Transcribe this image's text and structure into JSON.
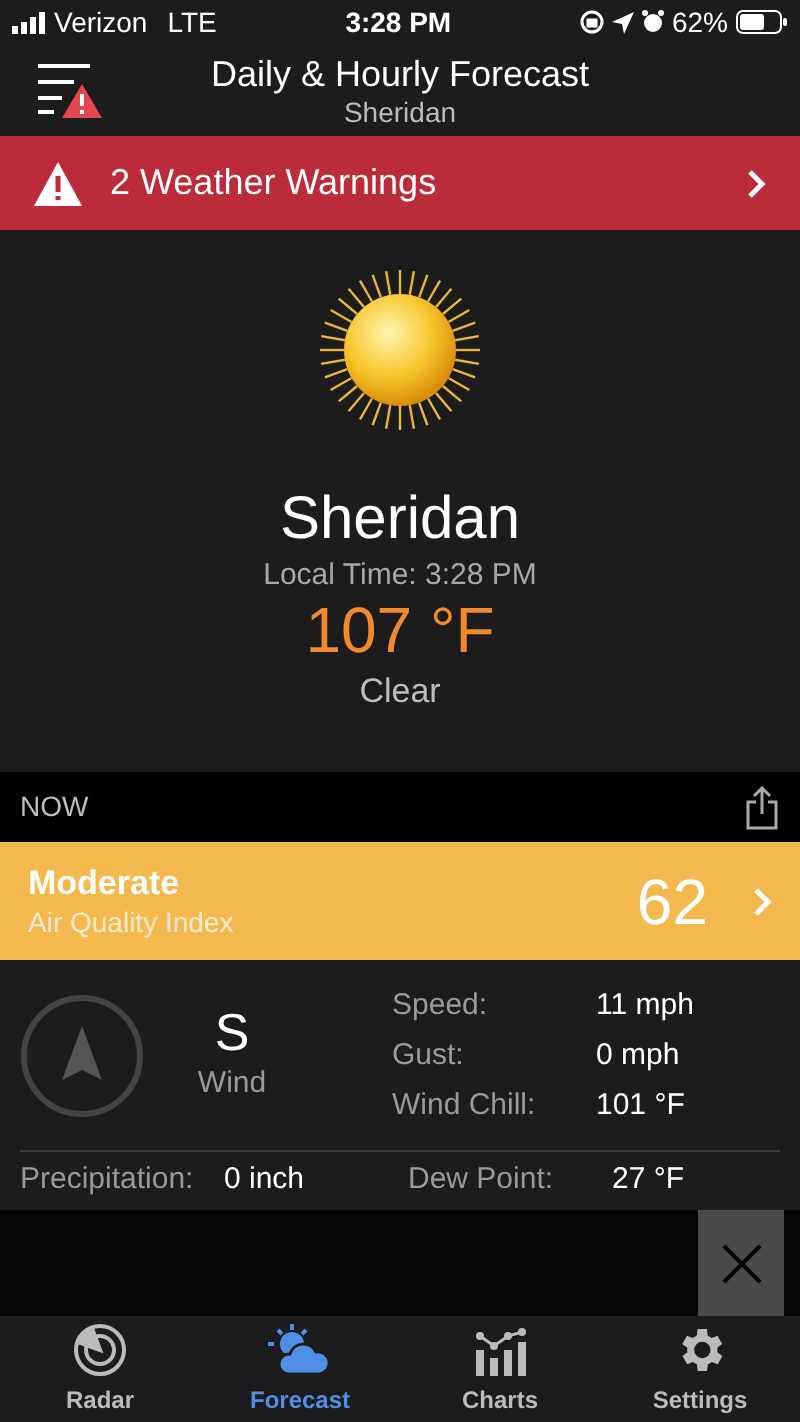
{
  "status_bar": {
    "carrier": "Verizon",
    "network": "LTE",
    "time": "3:28 PM",
    "battery": "62%"
  },
  "header": {
    "title": "Daily & Hourly Forecast",
    "subtitle": "Sheridan"
  },
  "warning_banner": {
    "text": "2 Weather Warnings"
  },
  "current": {
    "city": "Sheridan",
    "local_time": "Local Time: 3:28 PM",
    "temperature": "107 °F",
    "condition": "Clear"
  },
  "now_bar": {
    "label": "NOW"
  },
  "air_quality": {
    "category": "Moderate",
    "label": "Air Quality Index",
    "value": "62",
    "color": "#f3b94f"
  },
  "wind": {
    "direction": "S",
    "label": "Wind",
    "details": [
      {
        "label": "Speed:",
        "value": "11 mph"
      },
      {
        "label": "Gust:",
        "value": "0 mph"
      },
      {
        "label": "Wind Chill:",
        "value": "101 °F"
      }
    ]
  },
  "extra": [
    {
      "label": "Precipitation:",
      "value": "0 inch"
    },
    {
      "label": "Dew Point:",
      "value": "27 °F"
    }
  ],
  "tabs": [
    {
      "label": "Radar",
      "kind": "radar",
      "selected": false
    },
    {
      "label": "Forecast",
      "kind": "forecast",
      "selected": true
    },
    {
      "label": "Charts",
      "kind": "charts",
      "selected": false
    },
    {
      "label": "Settings",
      "kind": "settings",
      "selected": false
    }
  ]
}
